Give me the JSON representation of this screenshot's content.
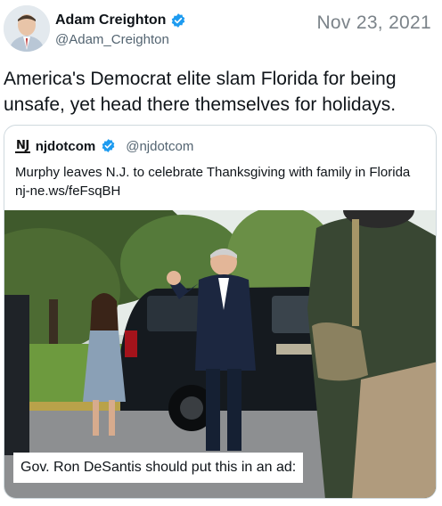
{
  "tweet": {
    "author_name": "Adam Creighton",
    "author_handle": "@Adam_Creighton",
    "date": "Nov 23, 2021",
    "text": "America's Democrat elite slam Florida for being unsafe, yet head there themselves for holidays.",
    "verified": true
  },
  "quote": {
    "logo_text": "NJ",
    "name": "njdotcom",
    "handle": "@njdotcom",
    "verified": true,
    "text": "Murphy leaves N.J. to celebrate Thanksgiving with family in Florida nj-ne.ws/feFsqBH",
    "image_caption": "Gov. Ron DeSantis should put this in an ad:"
  },
  "colors": {
    "verified_blue": "#1d9bf0",
    "secondary_text": "#536471",
    "border": "#cfd9de"
  },
  "icons": [
    "verified-badge-icon",
    "njdotcom-logo-icon"
  ]
}
